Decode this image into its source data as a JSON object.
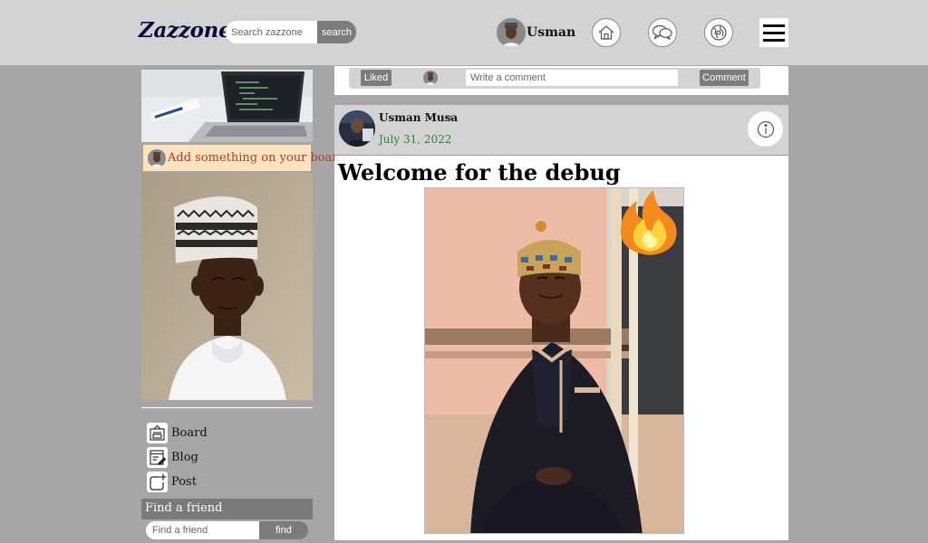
{
  "header": {
    "logo": "Zazzone",
    "search_placeholder": "Search zazzone",
    "search_label": "search",
    "user_name": "Usman"
  },
  "sidebar": {
    "board_prompt": "Add something on your board",
    "nav": [
      {
        "label": "Board",
        "icon": "board-icon"
      },
      {
        "label": "Blog",
        "icon": "blog-icon"
      },
      {
        "label": "Post",
        "icon": "post-icon"
      }
    ],
    "find_friend_title": "Find a friend",
    "find_friend_placeholder": "Find a friend",
    "find_label": "find"
  },
  "comment_bar": {
    "liked_label": "Liked",
    "comment_placeholder": "Write a comment",
    "comment_label": "Comment"
  },
  "post": {
    "author": "Usman Musa",
    "author_caret": "v",
    "date": "July 31, 2022",
    "title": "Welcome for the debug",
    "info_icon": "info-icon",
    "sticker": "fire-emoji"
  },
  "colors": {
    "page_bg": "#a6a6a6",
    "header_bg": "#d3d3d3",
    "button_gray": "#7c7c7c",
    "board_strip_bg": "#fbe3bd",
    "board_strip_text": "#b33a2a",
    "date_green": "#2a8a2a"
  }
}
